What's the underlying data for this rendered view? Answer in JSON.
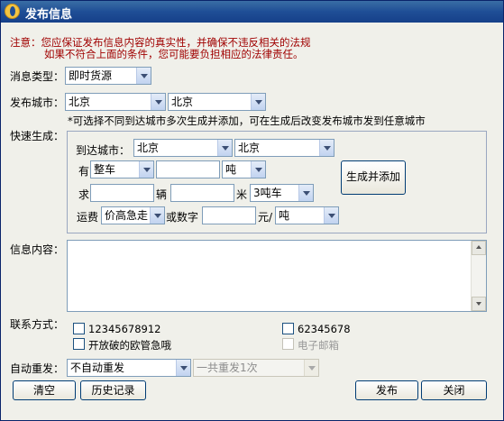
{
  "window": {
    "title": "发布信息",
    "icon": "app-logo-icon"
  },
  "notice": {
    "line1": "注意：您应保证发布信息内容的真实性，并确保不违反相关的法规",
    "line2": "如果不符合上面的条件，您可能要负担相应的法律责任。"
  },
  "message_type": {
    "label": "消息类型：",
    "value": "即时货源"
  },
  "publish_city": {
    "label": "发布城市：",
    "province": "北京",
    "city": "北京",
    "hint": "*可选择不同到达城市多次生成并添加，可在生成后改变发布城市发到任意城市"
  },
  "quick_generate": {
    "label": "快速生成：",
    "dest_label": "到达城市：",
    "dest_province": "北京",
    "dest_city": "北京",
    "have_label": "有",
    "have_type": "整车",
    "have_qty": "",
    "have_unit": "吨",
    "want_label": "求",
    "vehicle_count": "",
    "vehicle_unit_label": "辆",
    "length_value": "",
    "length_unit_label": "米",
    "vehicle_type": "3吨车",
    "freight_label": "运费",
    "freight_option": "价高急走",
    "or_number_label": "或数字",
    "price_value": "",
    "price_unit_label": "元/",
    "price_unit": "吨",
    "generate_button": "生成并添加"
  },
  "info_content": {
    "label": "信息内容：",
    "value": ""
  },
  "contact": {
    "label": "联系方式：",
    "options": [
      {
        "label": "12345678912",
        "checked": false,
        "enabled": true
      },
      {
        "label": "62345678",
        "checked": false,
        "enabled": true
      },
      {
        "label": "开放破的欧管急哦",
        "checked": false,
        "enabled": true
      },
      {
        "label": "电子邮箱",
        "checked": false,
        "enabled": false
      }
    ]
  },
  "auto_repeat": {
    "label": "自动重发：",
    "mode": "不自动重发",
    "count": "一共重发1次"
  },
  "buttons": {
    "clear": "清空",
    "history": "历史记录",
    "publish": "发布",
    "close": "关闭"
  },
  "colors": {
    "titlebar": "#1f4e96",
    "notice_text": "#a00000",
    "window_bg": "#f0f0ea",
    "input_border": "#7f9db9"
  }
}
